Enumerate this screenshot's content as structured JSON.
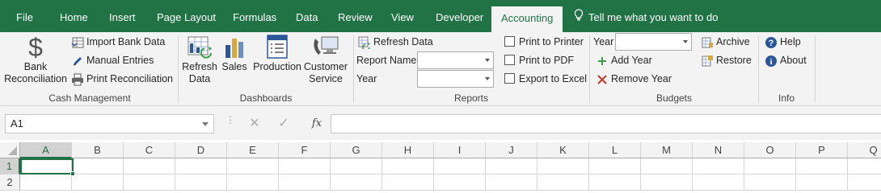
{
  "tabs": [
    {
      "label": "File"
    },
    {
      "label": "Home"
    },
    {
      "label": "Insert"
    },
    {
      "label": "Page Layout"
    },
    {
      "label": "Formulas"
    },
    {
      "label": "Data"
    },
    {
      "label": "Review"
    },
    {
      "label": "View"
    },
    {
      "label": "Developer"
    },
    {
      "label": "Accounting",
      "active": true
    }
  ],
  "tell_me": "Tell me what you want to do",
  "colors": {
    "brand": "#217346",
    "ribbon_bg": "#f3f3f3",
    "accent_blue": "#2b579a",
    "remove_red": "#c0392b",
    "add_green": "#3c9c4c"
  },
  "ribbon": {
    "cash_management": {
      "label": "Cash Management",
      "bank_reconciliation": "Bank Reconciliation",
      "bank_reconciliation_line1": "Bank",
      "bank_reconciliation_line2": "Reconciliation",
      "import_bank_data": "Import Bank Data",
      "manual_entries": "Manual Entries",
      "print_reconciliation": "Print Reconciliation"
    },
    "dashboards": {
      "label": "Dashboards",
      "refresh_line1": "Refresh",
      "refresh_line2": "Data",
      "sales": "Sales",
      "production": "Production",
      "customer_line1": "Customer",
      "customer_line2": "Service"
    },
    "reports": {
      "label": "Reports",
      "refresh_data": "Refresh Data",
      "report_name_label": "Report Name",
      "report_name_value": "",
      "year_label": "Year",
      "year_value": "",
      "print_to_printer": "Print to Printer",
      "print_to_pdf": "Print to PDF",
      "export_to_excel": "Export to Excel"
    },
    "budgets": {
      "label": "Budgets",
      "year_label": "Year",
      "year_value": "",
      "add_year": "Add Year",
      "remove_year": "Remove Year",
      "archive": "Archive",
      "restore": "Restore"
    },
    "info": {
      "label": "Info",
      "help": "Help",
      "about": "About"
    }
  },
  "formula_bar": {
    "name_box": "A1",
    "fx": "fx",
    "formula_value": ""
  },
  "sheet": {
    "columns": [
      "A",
      "B",
      "C",
      "D",
      "E",
      "F",
      "G",
      "H",
      "I",
      "J",
      "K",
      "L",
      "M",
      "N",
      "O",
      "P",
      "Q"
    ],
    "rows": [
      "1",
      "2"
    ],
    "active_cell": "A1"
  },
  "icons": {
    "bank_reconciliation": "dollar-icon",
    "import_bank_data": "import-table-icon",
    "manual_entries": "pencil-icon",
    "print_reconciliation": "printer-icon",
    "refresh_data": "refresh-chart-icon",
    "sales": "bar-chart-icon",
    "production": "form-list-icon",
    "customer_service": "phone-computer-icon",
    "archive": "archive-icon",
    "restore": "restore-icon",
    "help": "help-icon",
    "about": "info-icon"
  }
}
